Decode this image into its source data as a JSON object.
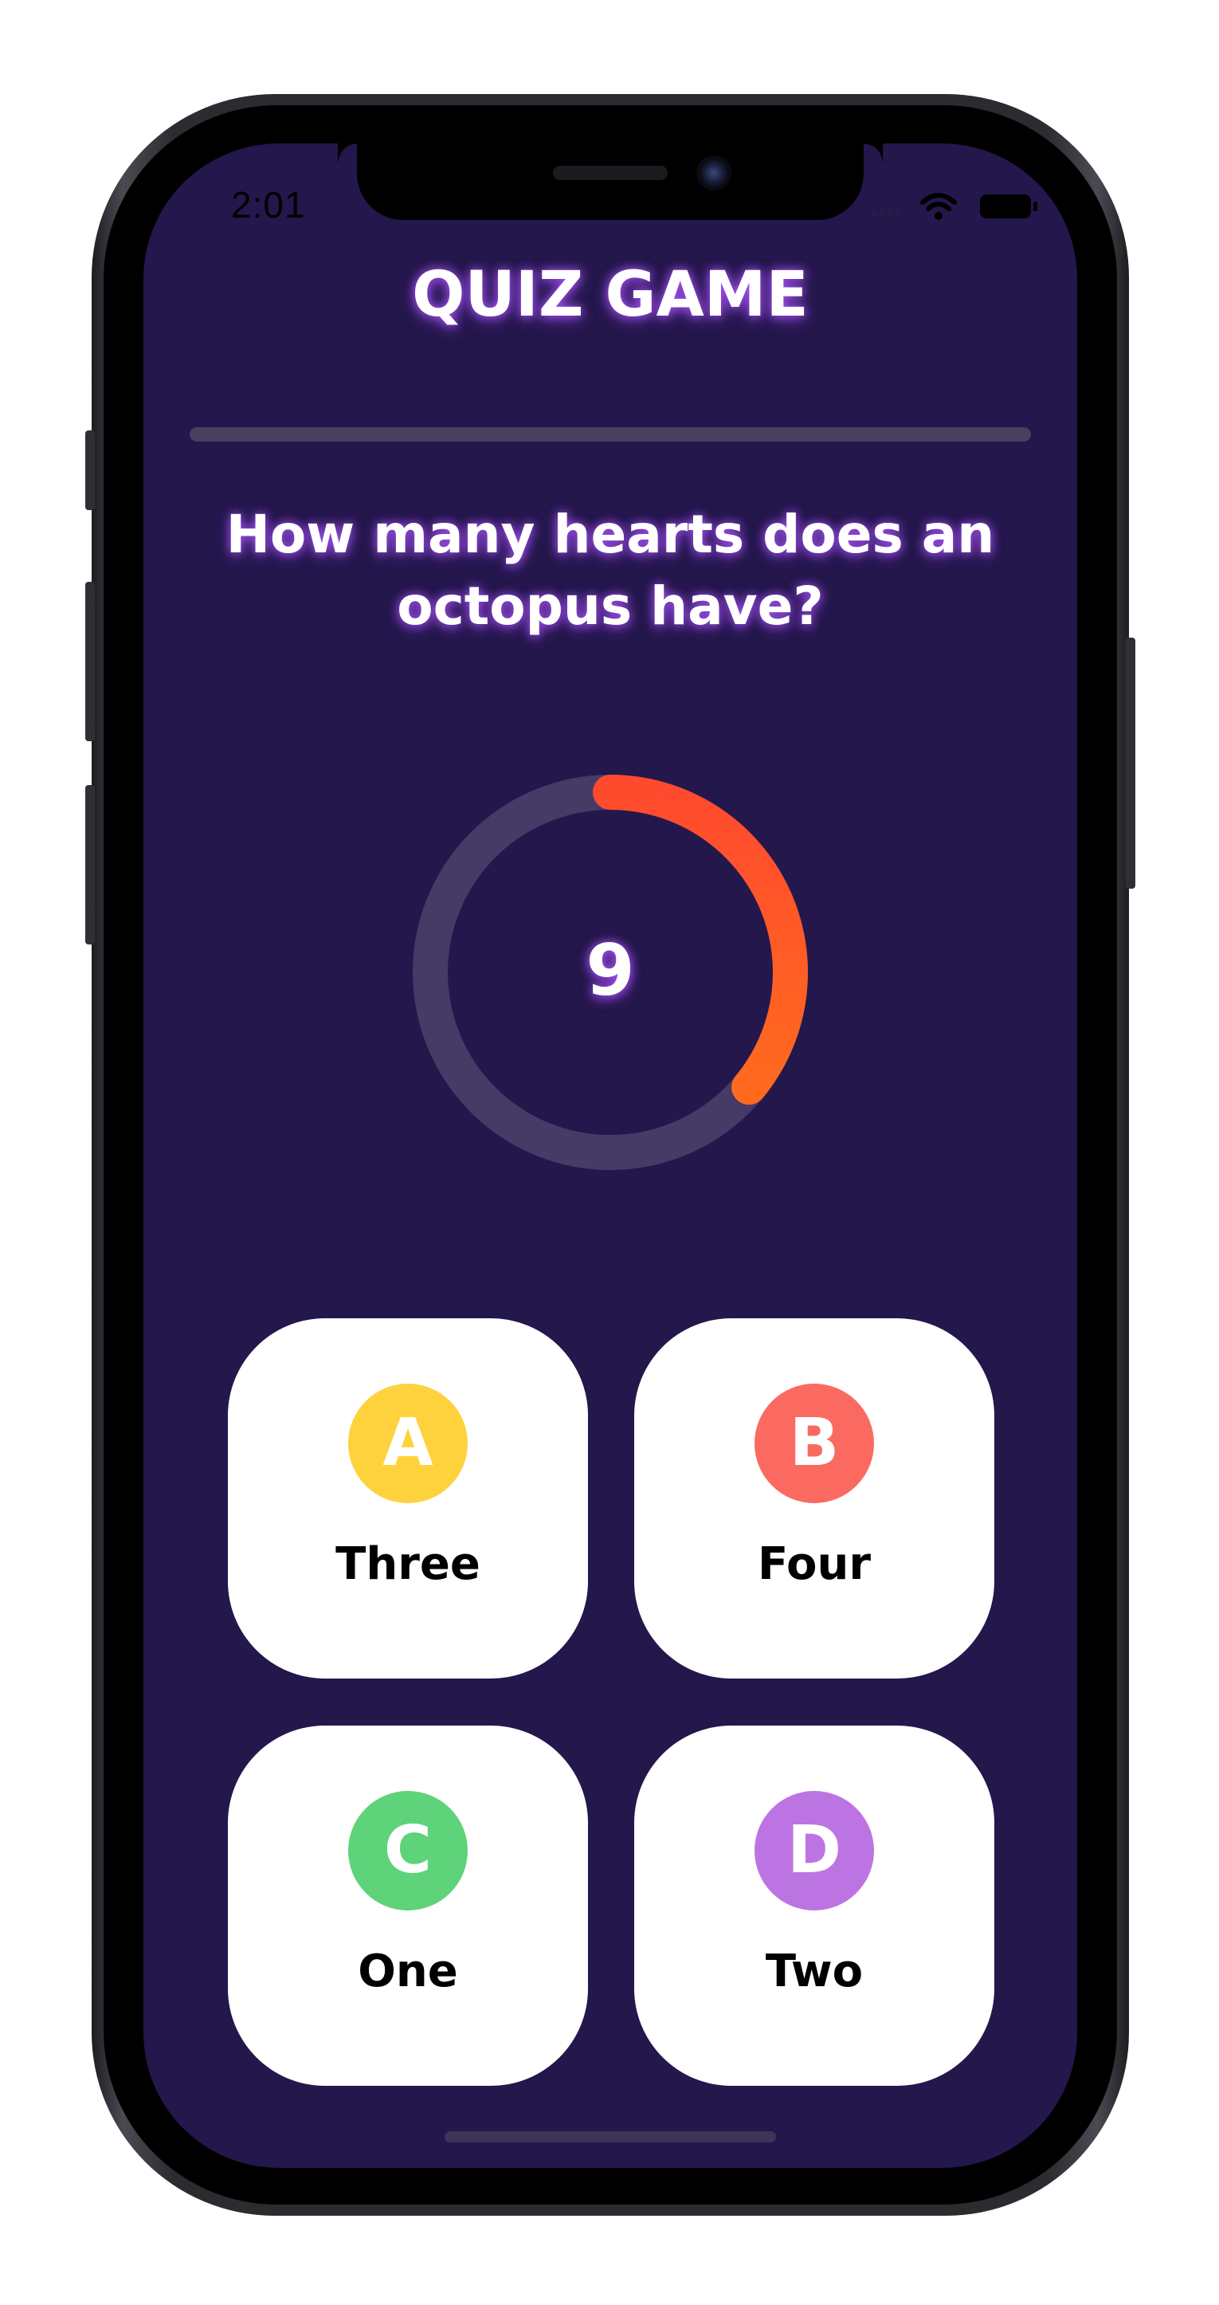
{
  "status_bar": {
    "time": "2:01",
    "icons": [
      "cellular-icon",
      "wifi-icon",
      "battery-icon"
    ]
  },
  "app": {
    "title": "QUIZ GAME"
  },
  "progress": {
    "fraction": 0
  },
  "question": {
    "text": "How many hearts does an octopus have?"
  },
  "timer": {
    "seconds_left": "9",
    "remaining_fraction": 0.36
  },
  "answers": [
    {
      "letter": "A",
      "label": "Three",
      "color": "#fdd23d"
    },
    {
      "letter": "B",
      "label": "Four",
      "color": "#fb6a60"
    },
    {
      "letter": "C",
      "label": "One",
      "color": "#5ed37a"
    },
    {
      "letter": "D",
      "label": "Two",
      "color": "#bd74e3"
    }
  ],
  "colors": {
    "background": "#24174c",
    "timer_track": "#463a66",
    "timer_arc_start": "#ff4a2e",
    "timer_arc_end": "#ff6a1f",
    "text_glow": "#a855f7"
  }
}
